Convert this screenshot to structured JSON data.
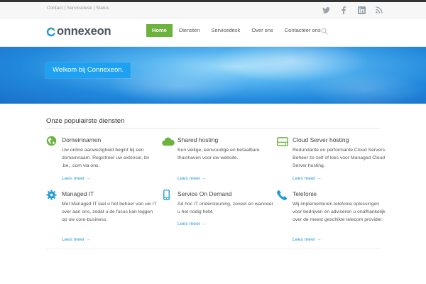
{
  "topbar": {
    "links": [
      "Contact",
      "Servicedesk",
      "Status"
    ],
    "separator": "|",
    "social": [
      "twitter-icon",
      "facebook-icon",
      "linkedin-icon",
      "rss-icon"
    ]
  },
  "header": {
    "logo_text": "onnexeon",
    "nav": [
      "Home",
      "Diensten",
      "Servicedesk",
      "Over ons",
      "Contacteer ons"
    ],
    "active": "Home"
  },
  "hero": {
    "welcome": "Welkom bij Connexeon."
  },
  "services": {
    "heading": "Onze populairste diensten",
    "more_label": "Lees meer →",
    "items": [
      {
        "title": "Domeinnamen",
        "desc": "Uw online aanwezigheid begint bij een domeinnaam. Registreer uw extensie, bv .be, .com via ons.",
        "icon": "globe-icon",
        "color": "#6cb33e"
      },
      {
        "title": "Shared hosting",
        "desc": "Een veilige, eenvoudige en betaalbare thuishaven voor uw website.",
        "icon": "cloud-icon",
        "color": "#6cb33e"
      },
      {
        "title": "Cloud Server hosting",
        "desc": "Redundante en performante Cloud Servers. Beheer ze zelf of kies voor Managed Cloud Server hosting.",
        "icon": "server-icon",
        "color": "#6cb33e"
      },
      {
        "title": "Managed IT",
        "desc": "Met Managed IT laat u het beheer van uw IT over aan ons, zodat u de focus kan leggen op uw core-business.",
        "icon": "gear-icon",
        "color": "#1f9bd9"
      },
      {
        "title": "Service On Demand",
        "desc": "Ad hoc IT ondersteuning, zoveel en wanneer u het nodig hebt.",
        "icon": "mobile-icon",
        "color": "#1f9bd9"
      },
      {
        "title": "Telefonie",
        "desc": "Wij implementeren telefonie oplossingen voor bedrijven en adviseren u onafhankelijk over de meest geschikte telecom provider.",
        "icon": "phone-icon",
        "color": "#1f9bd9"
      }
    ]
  },
  "colors": {
    "accent_green": "#6cb33e",
    "accent_blue": "#1f9bd9",
    "welcome_bg": "#1da1f0"
  }
}
